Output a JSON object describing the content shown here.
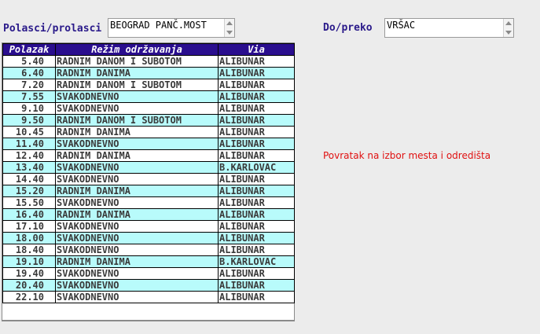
{
  "from": {
    "label": "Polasci/prolasci",
    "value": "BEOGRAD PANČ.MOST"
  },
  "to": {
    "label": "Do/preko",
    "value": "VRŠAC"
  },
  "table": {
    "headers": [
      "Polazak",
      "Režim održavanja",
      "Via"
    ],
    "rows": [
      [
        "5.40",
        "RADNIM DANOM I SUBOTOM",
        "ALIBUNAR"
      ],
      [
        "6.40",
        "RADNIM DANIMA",
        "ALIBUNAR"
      ],
      [
        "7.20",
        "RADNIM DANOM I SUBOTOM",
        "ALIBUNAR"
      ],
      [
        "7.55",
        "SVAKODNEVNO",
        "ALIBUNAR"
      ],
      [
        "9.10",
        "SVAKODNEVNO",
        "ALIBUNAR"
      ],
      [
        "9.50",
        "RADNIM DANOM I SUBOTOM",
        "ALIBUNAR"
      ],
      [
        "10.45",
        "RADNIM DANIMA",
        "ALIBUNAR"
      ],
      [
        "11.40",
        "SVAKODNEVNO",
        "ALIBUNAR"
      ],
      [
        "12.40",
        "RADNIM DANIMA",
        "ALIBUNAR"
      ],
      [
        "13.40",
        "SVAKODNEVNO",
        "B.KARLOVAC"
      ],
      [
        "14.40",
        "SVAKODNEVNO",
        "ALIBUNAR"
      ],
      [
        "15.20",
        "RADNIM DANIMA",
        "ALIBUNAR"
      ],
      [
        "15.50",
        "SVAKODNEVNO",
        "ALIBUNAR"
      ],
      [
        "16.40",
        "RADNIM DANIMA",
        "ALIBUNAR"
      ],
      [
        "17.10",
        "SVAKODNEVNO",
        "ALIBUNAR"
      ],
      [
        "18.00",
        "SVAKODNEVNO",
        "ALIBUNAR"
      ],
      [
        "18.40",
        "SVAKODNEVNO",
        "ALIBUNAR"
      ],
      [
        "19.10",
        "RADNIM DANIMA",
        "B.KARLOVAC"
      ],
      [
        "19.40",
        "SVAKODNEVNO",
        "ALIBUNAR"
      ],
      [
        "20.40",
        "SVAKODNEVNO",
        "ALIBUNAR"
      ],
      [
        "22.10",
        "SVAKODNEVNO",
        "ALIBUNAR"
      ]
    ]
  },
  "back_link": {
    "label": "Povratak na izbor mesta i odredišta"
  },
  "colors": {
    "label_text": "#2a1a8a",
    "header_bg": "#2a0e8e",
    "row_alt_bg": "#b8fbfb",
    "link": "#e01010"
  }
}
